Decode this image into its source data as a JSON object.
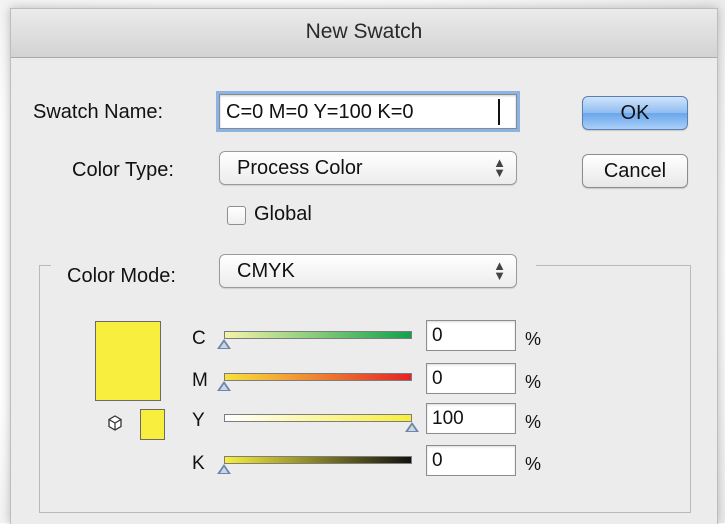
{
  "dialog": {
    "title": "New Swatch",
    "swatch_name_label": "Swatch Name:",
    "swatch_name_value": "C=0 M=0 Y=100 K=0",
    "color_type_label": "Color Type:",
    "color_type_value": "Process Color",
    "global_label": "Global",
    "global_checked": false,
    "color_mode_label": "Color Mode:",
    "color_mode_value": "CMYK",
    "ok_label": "OK",
    "cancel_label": "Cancel",
    "swatch_color": "#f8ee3d",
    "sliders": [
      {
        "channel": "C",
        "value": "0",
        "unit": "%",
        "level": 0,
        "gradient": [
          "#f5f3a8",
          "#11a24a"
        ]
      },
      {
        "channel": "M",
        "value": "0",
        "unit": "%",
        "level": 0,
        "gradient": [
          "#f8e13a",
          "#e52326"
        ]
      },
      {
        "channel": "Y",
        "value": "100",
        "unit": "%",
        "level": 1,
        "gradient": [
          "#ffffff",
          "#f8ee3d"
        ]
      },
      {
        "channel": "K",
        "value": "0",
        "unit": "%",
        "level": 0,
        "gradient": [
          "#f8ee3d",
          "#111111"
        ]
      }
    ]
  }
}
